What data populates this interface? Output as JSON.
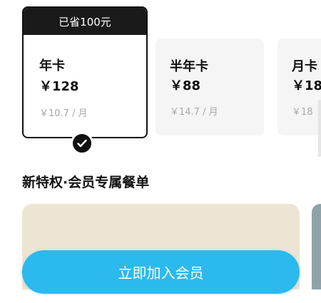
{
  "plans": {
    "annual": {
      "badge": "已省100元",
      "name": "年卡",
      "price": "￥128",
      "monthly": "￥10.7 / 月",
      "selected": true
    },
    "half_year": {
      "name": "半年卡",
      "price": "￥88",
      "monthly": "￥14.7 / 月"
    },
    "monthly": {
      "name": "月卡",
      "price": "￥18",
      "monthly": "￥18"
    }
  },
  "section": {
    "title": "新特权·会员专属餐单"
  },
  "cta": {
    "label": "立即加入会员"
  },
  "colors": {
    "accent": "#2cb9ee",
    "selected_border": "#111111",
    "card_bg": "#f5f5f5",
    "perk_card_bg": "#ece5d3"
  },
  "icons": {
    "selected_check": "check-icon"
  }
}
